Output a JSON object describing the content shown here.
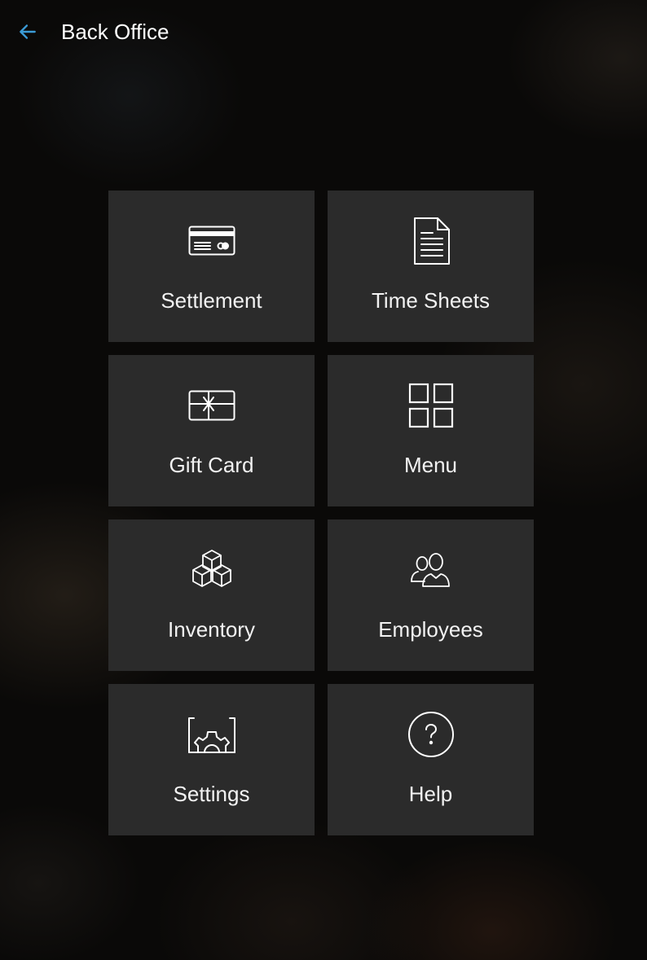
{
  "header": {
    "back_icon": "arrow-left-icon",
    "title": "Back Office"
  },
  "colors": {
    "accent": "#3b9bd6",
    "tile_background": "#2b2b2b",
    "text": "#ffffff"
  },
  "tiles": [
    {
      "label": "Settlement",
      "icon": "credit-card-icon"
    },
    {
      "label": "Time Sheets",
      "icon": "document-icon"
    },
    {
      "label": "Gift Card",
      "icon": "gift-card-icon"
    },
    {
      "label": "Menu",
      "icon": "grid-icon"
    },
    {
      "label": "Inventory",
      "icon": "boxes-icon"
    },
    {
      "label": "Employees",
      "icon": "people-icon"
    },
    {
      "label": "Settings",
      "icon": "gear-icon"
    },
    {
      "label": "Help",
      "icon": "question-circle-icon"
    }
  ]
}
